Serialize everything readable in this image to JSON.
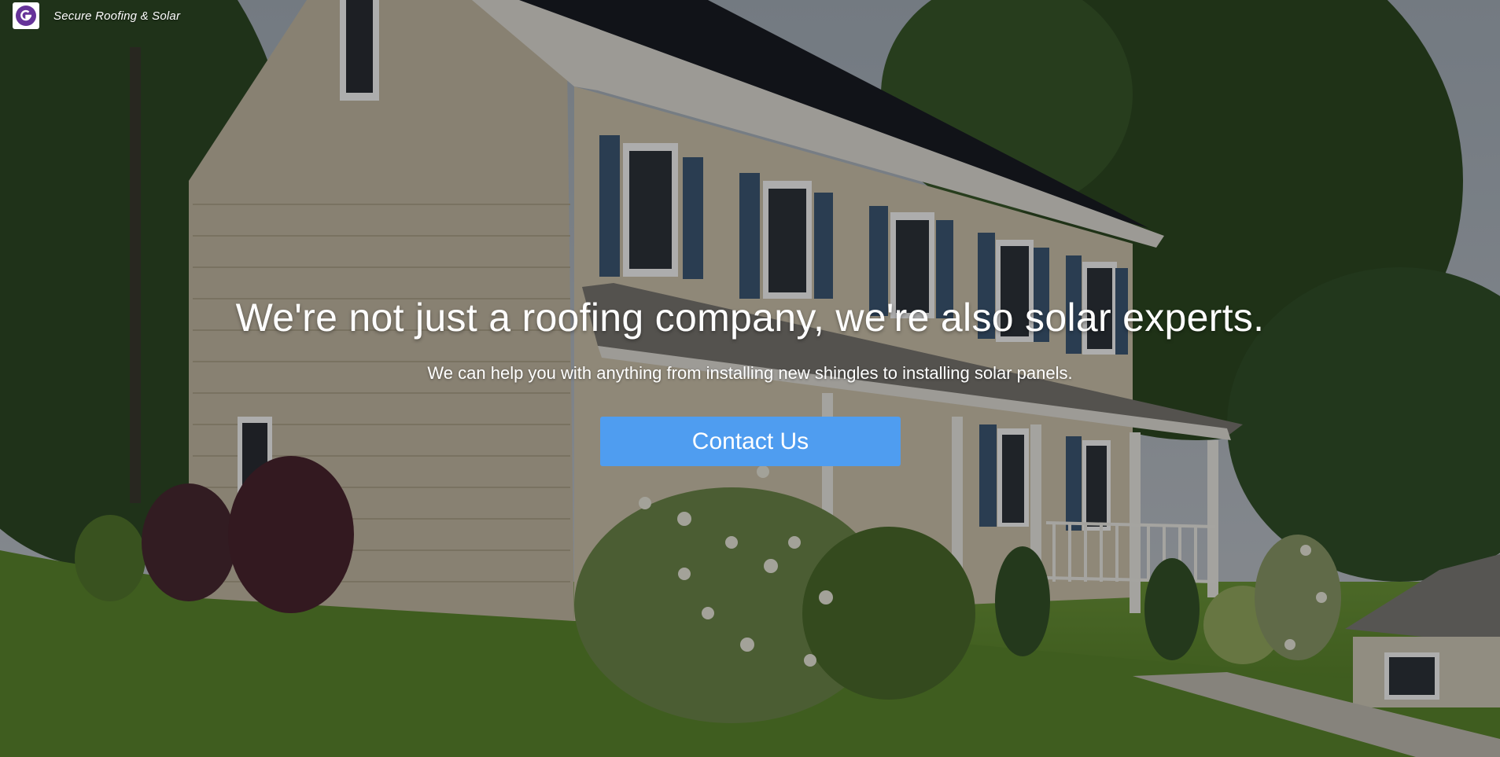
{
  "header": {
    "brand_name": "Secure Roofing & Solar",
    "logo_icon": "gatsby-logo-icon",
    "logo_color": "#663399"
  },
  "hero": {
    "background_image": "house-with-solar-roof-photo",
    "headline": "We're not just a roofing company, we're also solar experts.",
    "subheadline": "We can help you with anything from installing new shingles to installing solar panels.",
    "cta_label": "Contact Us",
    "cta_color": "#4f9df0"
  }
}
